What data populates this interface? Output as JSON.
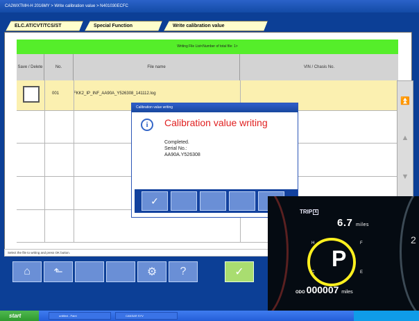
{
  "window": {
    "title": "CA2WXTMH-H 2016MY  >  Write calibration value  >  N401030ECFC"
  },
  "tabs": [
    {
      "label": "ELC.AT/CVT/TCS/ST"
    },
    {
      "label": "Special Function"
    },
    {
      "label": "Write calibration value"
    }
  ],
  "table": {
    "banner": "Writing File List<Number of total file: 1>",
    "headers": [
      "Save / Delete",
      "No.",
      "File name",
      "VIN / Chasis No."
    ],
    "rows": [
      {
        "no": "001",
        "file": "FKK2_IP_INF_AA90A_Y526308_141112.log",
        "vin": ""
      }
    ]
  },
  "scroll": {
    "up_icon": "double-chevron-up-icon",
    "mid_icon": "chevron-up-icon",
    "down_icon": "chevron-down-icon"
  },
  "hint": "Select the file to writing and press  OK button.",
  "toolbar": {
    "icons": [
      "home-icon",
      "back-arrow-icon",
      "blank",
      "settings-icon",
      "help-icon",
      "check-icon"
    ]
  },
  "dialog": {
    "title": "Calibration value writing",
    "heading": "Calibration value writing",
    "lines": [
      "Completed.",
      "Serial No.:",
      "AA90A.Y526308"
    ],
    "ok_icon": "check-icon"
  },
  "taskbar": {
    "start": "start",
    "items": [
      "untitled - Paint",
      "CANSAR SYV"
    ]
  },
  "cluster": {
    "trip_label": "TRIP",
    "trip_letter": "A",
    "trip_value": "6.7",
    "trip_unit": "miles",
    "gear": "P",
    "odo_label": "ODO",
    "odo_value": "000007",
    "odo_unit": "miles",
    "temp_h": "H",
    "temp_c": "C",
    "fuel_f": "F",
    "fuel_e": "E",
    "gauge_number": "2"
  },
  "colors": {
    "accent": "#0c3f96",
    "banner": "#55ee2a",
    "selected_row": "#fbf0b0",
    "error_heading": "#e02020",
    "gear_circle": "#fff01f"
  }
}
